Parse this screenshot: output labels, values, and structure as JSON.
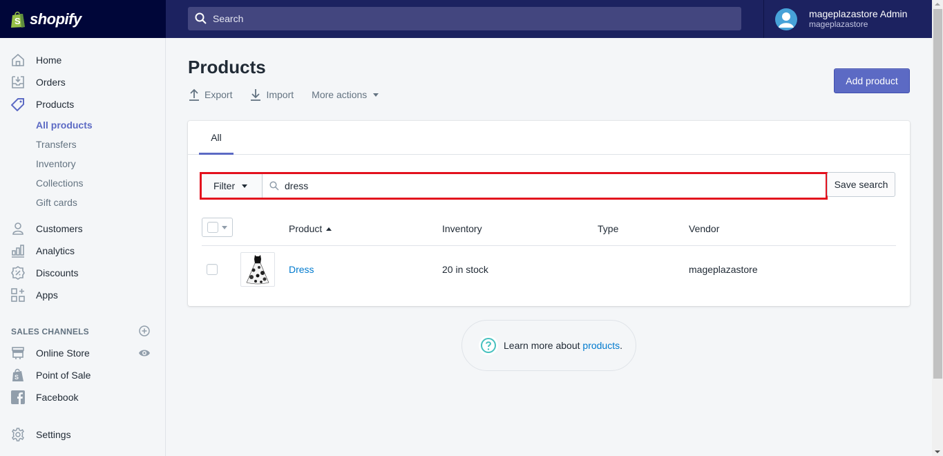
{
  "topbar": {
    "brand": "shopify",
    "search_placeholder": "Search",
    "user": {
      "name": "mageplazastore Admin",
      "store": "mageplazastore"
    }
  },
  "sidebar": {
    "items": [
      {
        "label": "Home",
        "icon": "home-icon"
      },
      {
        "label": "Orders",
        "icon": "orders-icon"
      },
      {
        "label": "Products",
        "icon": "tag-icon"
      }
    ],
    "product_subitems": [
      {
        "label": "All products",
        "active": true
      },
      {
        "label": "Transfers"
      },
      {
        "label": "Inventory"
      },
      {
        "label": "Collections"
      },
      {
        "label": "Gift cards"
      }
    ],
    "items2": [
      {
        "label": "Customers",
        "icon": "customer-icon"
      },
      {
        "label": "Analytics",
        "icon": "analytics-icon"
      },
      {
        "label": "Discounts",
        "icon": "discount-icon"
      },
      {
        "label": "Apps",
        "icon": "apps-icon"
      }
    ],
    "sales_channels_label": "SALES CHANNELS",
    "channels": [
      {
        "label": "Online Store",
        "icon": "store-icon"
      },
      {
        "label": "Point of Sale",
        "icon": "shopify-bag-icon"
      },
      {
        "label": "Facebook",
        "icon": "facebook-icon"
      }
    ],
    "settings_label": "Settings"
  },
  "page": {
    "title": "Products",
    "actions": {
      "export": "Export",
      "import": "Import",
      "more": "More actions"
    },
    "add_button": "Add product",
    "tabs": [
      {
        "label": "All",
        "active": true
      }
    ],
    "filter": {
      "button": "Filter",
      "query": "dress",
      "save_search": "Save search"
    },
    "table": {
      "columns": [
        "Product",
        "Inventory",
        "Type",
        "Vendor"
      ],
      "sort": {
        "column": "Product",
        "direction": "asc"
      },
      "rows": [
        {
          "product": "Dress",
          "inventory": "20 in stock",
          "type": "",
          "vendor": "mageplazastore"
        }
      ]
    },
    "help": {
      "prefix": "Learn more about ",
      "link": "products",
      "suffix": "."
    }
  },
  "colors": {
    "accent": "#5c6ac4",
    "link": "#007ace",
    "highlight": "#e3111d",
    "topbar": "#1c2260"
  }
}
